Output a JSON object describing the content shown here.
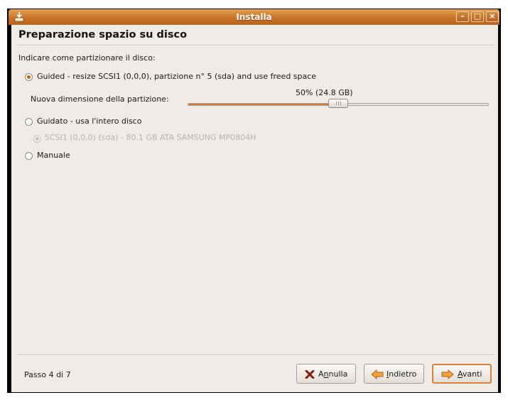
{
  "window": {
    "title": "Installa"
  },
  "page": {
    "title": "Preparazione spazio su disco",
    "instruction": "Indicare come partizionare il disco:"
  },
  "options": {
    "guided_resize": {
      "label": "Guided - resize SCSI1 (0,0,0), partizione n° 5 (sda) and use freed space",
      "selected": true
    },
    "new_size_label": "Nuova dimensione della partizione:",
    "slider": {
      "value_text": "50% (24.8 GB)",
      "fraction": 0.5
    },
    "guided_entire": {
      "label": "Guidato - usa l'intero disco",
      "selected": false
    },
    "disk_option": {
      "label": "SCSI1 (0,0,0) (sda) - 80.1 GB ATA SAMSUNG MP0804H",
      "selected": true,
      "enabled": false
    },
    "manual": {
      "label": "Manuale",
      "selected": false
    }
  },
  "footer": {
    "step": "Passo 4 di 7",
    "cancel": {
      "mnemonic": "n",
      "rest": "nulla",
      "prefix": "A",
      "icon": "x-cancel-icon"
    },
    "back": {
      "prefix": "",
      "mnemonic": "I",
      "rest": "ndietro",
      "icon": "arrow-left-icon"
    },
    "forward": {
      "prefix": "",
      "mnemonic": "A",
      "rest": "vanti",
      "icon": "arrow-right-icon"
    }
  },
  "colors": {
    "titlebar": "#c9752a",
    "accent": "#d57b2f",
    "background": "#efebe6"
  }
}
